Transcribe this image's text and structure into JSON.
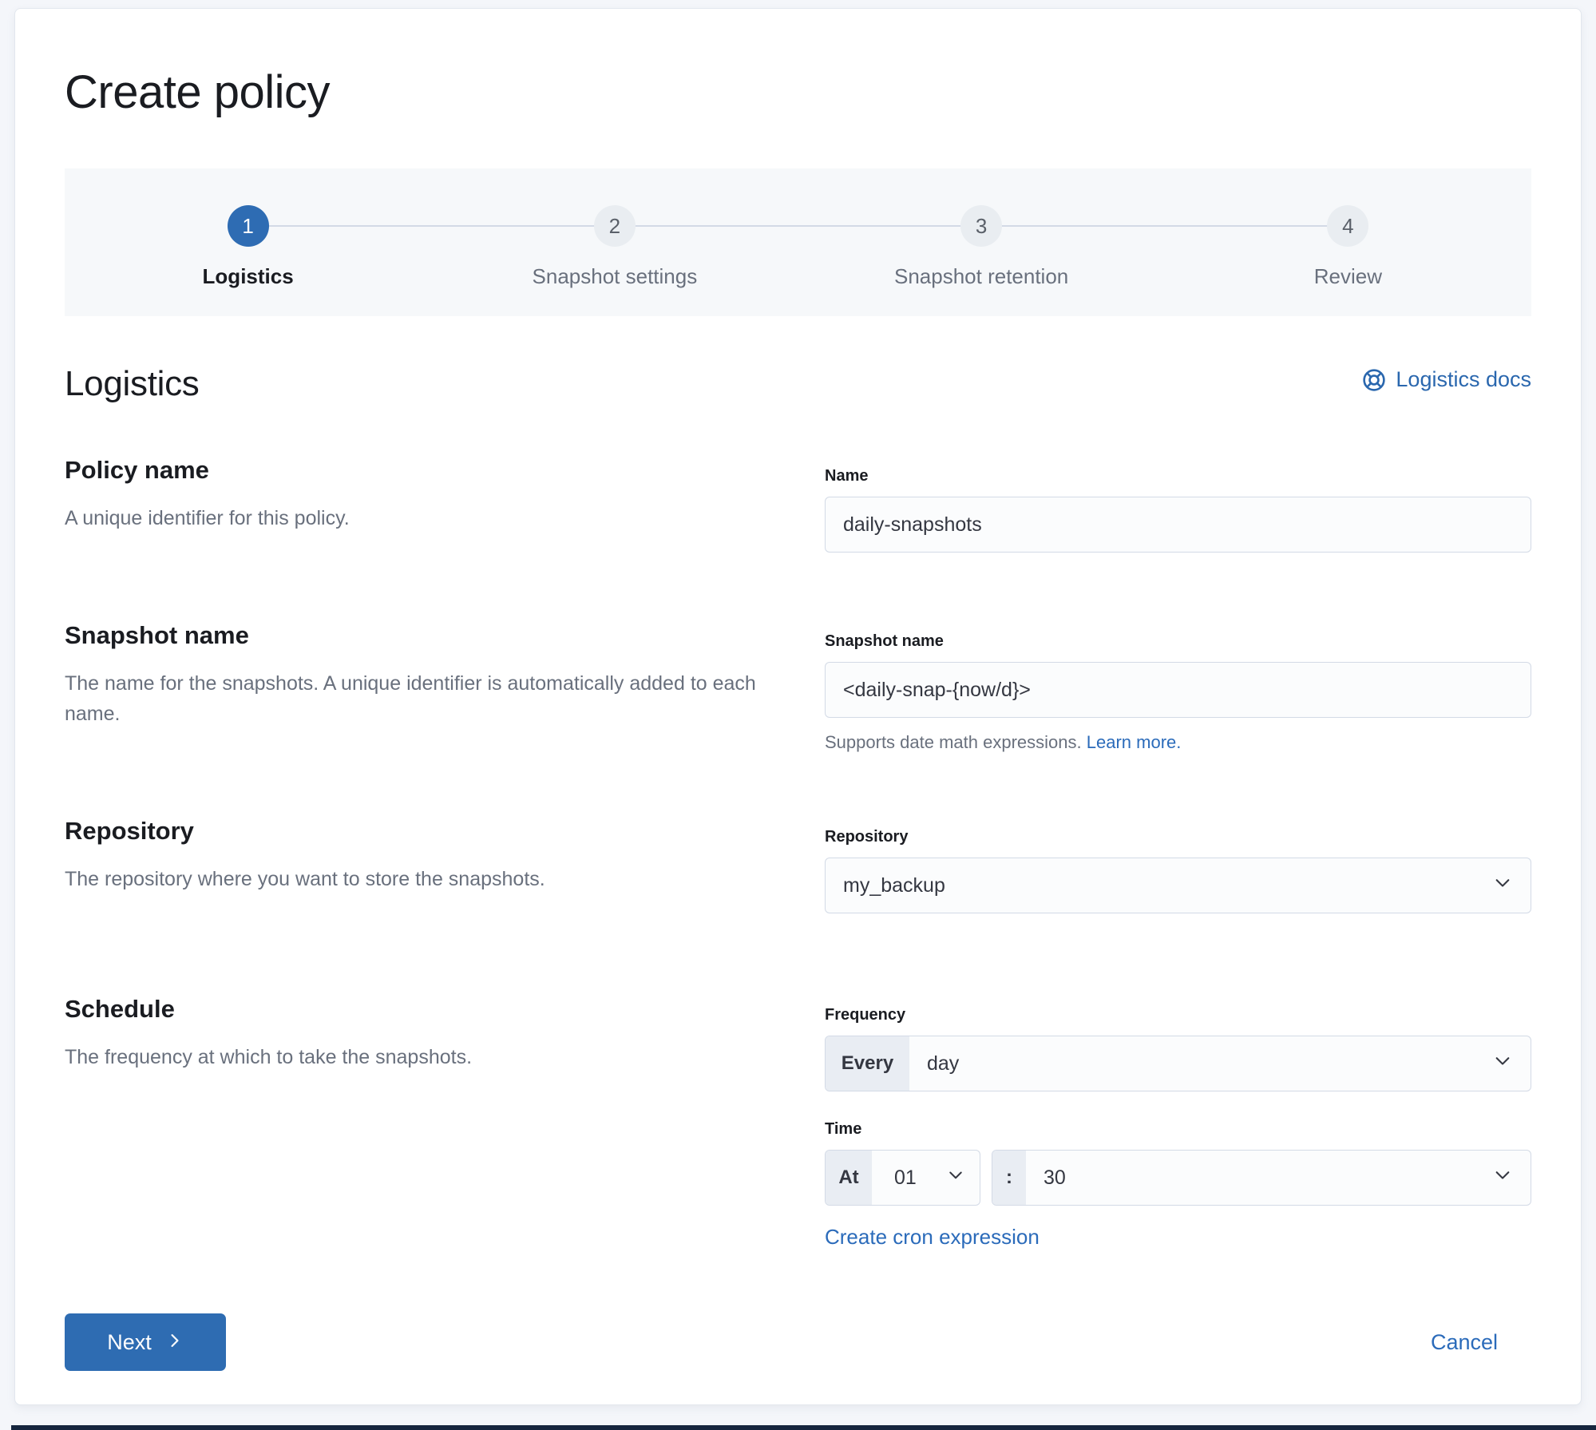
{
  "page": {
    "title": "Create policy"
  },
  "stepper": {
    "steps": [
      {
        "number": "1",
        "label": "Logistics"
      },
      {
        "number": "2",
        "label": "Snapshot settings"
      },
      {
        "number": "3",
        "label": "Snapshot retention"
      },
      {
        "number": "4",
        "label": "Review"
      }
    ]
  },
  "section": {
    "title": "Logistics",
    "docs_link_label": "Logistics docs"
  },
  "rows": {
    "policy_name": {
      "heading": "Policy name",
      "description": "A unique identifier for this policy.",
      "label": "Name",
      "value": "daily-snapshots"
    },
    "snapshot_name": {
      "heading": "Snapshot name",
      "description": "The name for the snapshots. A unique identifier is automatically added to each name.",
      "label": "Snapshot name",
      "value": "<daily-snap-{now/d}>",
      "help_text": "Supports date math expressions.",
      "help_link": "Learn more."
    },
    "repository": {
      "heading": "Repository",
      "description": "The repository where you want to store the snapshots.",
      "label": "Repository",
      "value": "my_backup"
    },
    "schedule": {
      "heading": "Schedule",
      "description": "The frequency at which to take the snapshots.",
      "frequency_label": "Frequency",
      "frequency_prepend": "Every",
      "frequency_value": "day",
      "time_label": "Time",
      "time_prepend": "At",
      "hour_value": "01",
      "time_separator": ":",
      "minute_value": "30",
      "cron_link": "Create cron expression"
    }
  },
  "footer": {
    "next_label": "Next",
    "cancel_label": "Cancel"
  },
  "colors": {
    "accent_blue": "#2e6cb3",
    "link_blue": "#2b6bba",
    "text_dark": "#1a1c21",
    "text_muted": "#69707d",
    "field_border": "#d3dae6",
    "field_bg": "#fbfcfd",
    "prepend_bg": "#e9edf3",
    "stepper_bg": "#f6f8fa",
    "page_bg": "#f4f6fa",
    "bottom_bar": "#16263e"
  }
}
